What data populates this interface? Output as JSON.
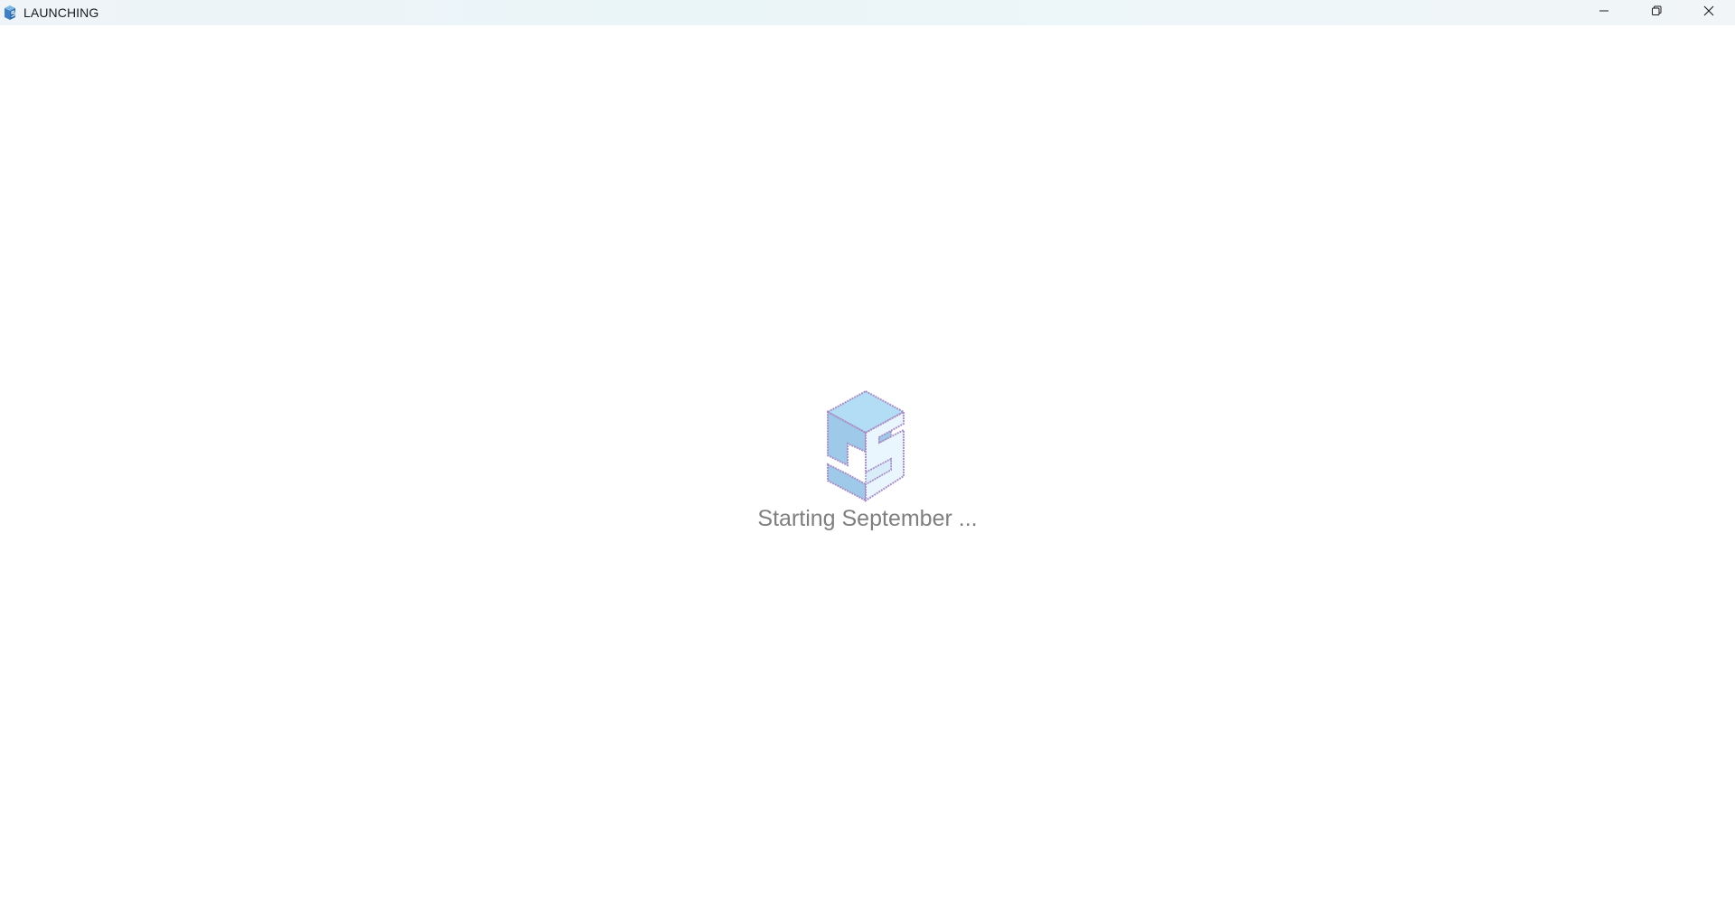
{
  "window": {
    "title": "LAUNCHING",
    "icons": {
      "app": "app-logo-icon",
      "minimize": "minimize-icon",
      "restore": "restore-icon",
      "close": "close-icon"
    }
  },
  "splash": {
    "logo": "app-logo",
    "status_text": "Starting September ..."
  },
  "colors": {
    "logo_top": "#b3dcf5",
    "logo_left": "#9ec9e8",
    "logo_outline": "#a88fc6",
    "status_text": "#7f7f7f"
  }
}
